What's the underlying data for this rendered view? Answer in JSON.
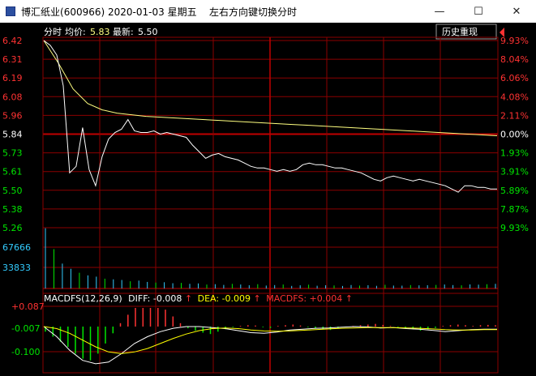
{
  "window": {
    "title_name": "博汇纸业",
    "title_code": "(600966)",
    "title_date": "2020-01-03",
    "title_weekday": "星期五",
    "hint": "左右方向键切换分时",
    "btn_min": "—",
    "btn_max": "☐",
    "btn_close": "✕"
  },
  "header": {
    "mode_label": "分时",
    "avg_label": "均价:",
    "avg_value": "5.83",
    "last_label": "最新:",
    "last_value": "5.50",
    "history_button": "历史重现"
  },
  "price_axis": {
    "left_labels": [
      "6.42",
      "6.31",
      "6.19",
      "6.08",
      "5.96",
      "5.84",
      "5.73",
      "5.61",
      "5.50",
      "5.38",
      "5.26"
    ],
    "right_labels": [
      "9.93%",
      "8.04%",
      "6.06%",
      "4.08%",
      "2.11%",
      "0.00%",
      "1.93%",
      "3.91%",
      "5.89%",
      "7.87%",
      "9.93%"
    ],
    "prev_close": 5.84
  },
  "volume_axis": {
    "labels": [
      "67666",
      "33833"
    ]
  },
  "macd": {
    "title": "MACDFS(12,26,9)",
    "diff_label": "DIFF:",
    "diff_value": "-0.008",
    "dea_label": "DEA:",
    "dea_value": "-0.009",
    "macdfs_label": "MACDFS:",
    "macdfs_value": "+0.004",
    "arrow": "↑",
    "axis_labels": [
      "+0.087",
      "-0.007",
      "-0.100"
    ]
  },
  "colors": {
    "up": "#ff3232",
    "down": "#00e600",
    "grid": "#8b0000",
    "price_line": "#ffffff",
    "avg_line": "#ffff80",
    "volume_label": "#33ccff",
    "dea_line": "#ffff00"
  },
  "chart_data": {
    "type": "line",
    "series": [
      {
        "name": "最新",
        "values": [
          6.42,
          6.39,
          6.33,
          6.14,
          5.6,
          5.64,
          5.88,
          5.62,
          5.52,
          5.7,
          5.81,
          5.85,
          5.87,
          5.93,
          5.86,
          5.85,
          5.85,
          5.86,
          5.84,
          5.85,
          5.84,
          5.83,
          5.82,
          5.77,
          5.73,
          5.69,
          5.71,
          5.72,
          5.7,
          5.69,
          5.68,
          5.66,
          5.64,
          5.63,
          5.63,
          5.62,
          5.61,
          5.62,
          5.61,
          5.62,
          5.65,
          5.66,
          5.65,
          5.65,
          5.64,
          5.63,
          5.63,
          5.62,
          5.61,
          5.6,
          5.58,
          5.56,
          5.55,
          5.57,
          5.58,
          5.57,
          5.56,
          5.55,
          5.56,
          5.55,
          5.54,
          5.53,
          5.52,
          5.5,
          5.48,
          5.52,
          5.52,
          5.51,
          5.51,
          5.5,
          5.5
        ]
      },
      {
        "name": "均价",
        "values": [
          6.42,
          6.28,
          6.12,
          6.03,
          5.99,
          5.97,
          5.96,
          5.95,
          5.945,
          5.94,
          5.935,
          5.93,
          5.925,
          5.92,
          5.915,
          5.91,
          5.905,
          5.9,
          5.895,
          5.89,
          5.885,
          5.88,
          5.875,
          5.87,
          5.865,
          5.86,
          5.855,
          5.85,
          5.845,
          5.84,
          5.835,
          5.83
        ]
      }
    ],
    "volume": [
      92000,
      60000,
      38000,
      30000,
      24000,
      20000,
      18000,
      15000,
      14000,
      13000,
      11000,
      12000,
      10000,
      9000,
      9500,
      8000,
      8500,
      7000,
      7800,
      6000,
      6500,
      5500,
      7000,
      6000,
      5000,
      6500,
      4500,
      5200,
      6000,
      4000,
      4800,
      5800,
      4200,
      5000,
      4600,
      3800,
      5200,
      4400,
      5000,
      4100,
      5600,
      4500,
      4300,
      5200,
      4800,
      5000,
      5400,
      6000,
      5200,
      4800,
      6200,
      5800,
      6400,
      7000
    ],
    "macd_diff": [
      0.0,
      -0.03,
      -0.07,
      -0.1,
      -0.11,
      -0.105,
      -0.08,
      -0.05,
      -0.03,
      -0.015,
      -0.005,
      0.0,
      0.0,
      -0.003,
      -0.006,
      -0.012,
      -0.018,
      -0.02,
      -0.016,
      -0.01,
      -0.008,
      -0.005,
      -0.004,
      -0.002,
      0.0,
      -0.001,
      -0.004,
      -0.003,
      -0.006,
      -0.008,
      -0.011,
      -0.015,
      -0.012,
      -0.009,
      -0.008,
      -0.008
    ],
    "macd_dea": [
      0.0,
      -0.006,
      -0.02,
      -0.04,
      -0.06,
      -0.075,
      -0.08,
      -0.075,
      -0.065,
      -0.05,
      -0.035,
      -0.022,
      -0.012,
      -0.006,
      -0.004,
      -0.006,
      -0.01,
      -0.013,
      -0.014,
      -0.013,
      -0.011,
      -0.009,
      -0.007,
      -0.005,
      -0.004,
      -0.003,
      -0.003,
      -0.003,
      -0.004,
      -0.005,
      -0.007,
      -0.009,
      -0.01,
      -0.01,
      -0.009,
      -0.009
    ],
    "macd_hist": [
      -0.015,
      -0.03,
      -0.045,
      -0.06,
      -0.08,
      -0.095,
      -0.1,
      -0.08,
      -0.05,
      -0.02,
      0.01,
      0.035,
      0.06,
      0.08,
      0.087,
      0.075,
      0.05,
      0.03,
      0.01,
      -0.005,
      -0.012,
      -0.018,
      -0.022,
      -0.015,
      -0.008,
      -0.002,
      0.002,
      0.004,
      0.003,
      -0.002,
      -0.004,
      0.002,
      0.004,
      0.006,
      0.003,
      -0.002,
      -0.005,
      -0.008,
      -0.01,
      -0.006,
      -0.002,
      0.002,
      0.004,
      0.006,
      0.008,
      0.005,
      0.002,
      -0.002,
      -0.005,
      -0.008,
      -0.012,
      -0.008,
      -0.004,
      0.002,
      0.004,
      0.006,
      0.004,
      0.002,
      0.004,
      0.005,
      0.004
    ],
    "ylim": [
      5.26,
      6.42
    ],
    "macd_ylim": [
      -0.1,
      0.087
    ],
    "grid": true
  }
}
